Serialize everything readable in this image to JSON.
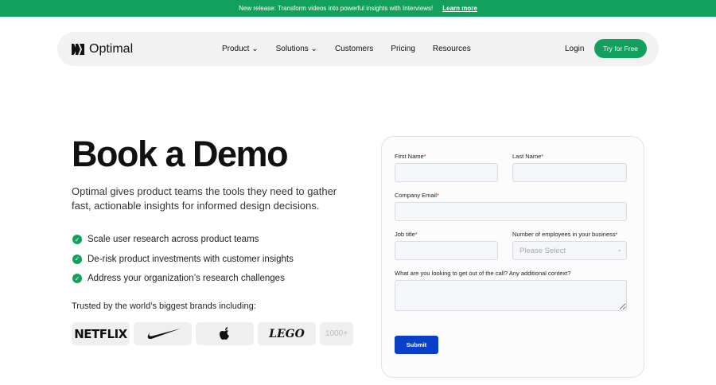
{
  "banner": {
    "text": "New release: Transform videos into powerful insights with Interviews!",
    "link": "Learn more"
  },
  "nav": {
    "logo": "Optimal",
    "links": [
      "Product",
      "Solutions",
      "Customers",
      "Pricing",
      "Resources"
    ],
    "login": "Login",
    "cta": "Try for Free"
  },
  "hero": {
    "title": "Book a Demo",
    "intro": "Optimal gives product teams the tools they need to gather fast, actionable insights for informed design decisions.",
    "checks": [
      "Scale user research across product teams",
      "De-risk product investments with customer insights",
      "Address your organization’s research challenges"
    ],
    "trusted": "Trusted by the world’s biggest brands including:",
    "brands": [
      "NETFLIX",
      "Nike",
      "Apple",
      "LEGO",
      "1000+"
    ]
  },
  "form": {
    "first_name": "First Name",
    "last_name": "Last Name",
    "email": "Company Email",
    "job": "Job title",
    "employees": "Number of employees in your business",
    "select_placeholder": "Please Select",
    "context": "What are you looking to get out of the call? Any additional context?",
    "required": "*",
    "submit": "Submit"
  },
  "colors": {
    "accent": "#13a05c",
    "submit": "#0a40c8"
  }
}
